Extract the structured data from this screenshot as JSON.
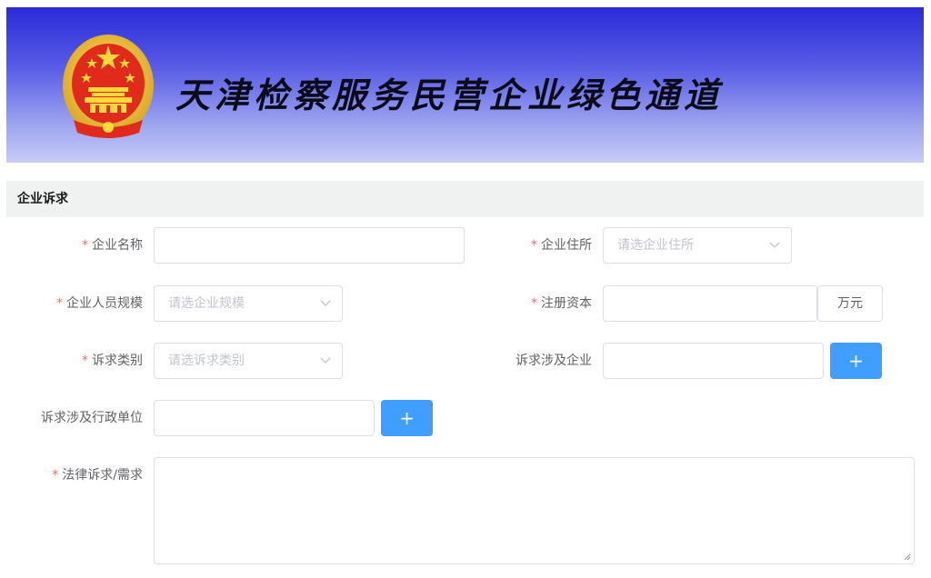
{
  "banner": {
    "title": "天津检察服务民营企业绿色通道",
    "emblem_icon": "national-emblem-icon"
  },
  "section": {
    "title": "企业诉求"
  },
  "form": {
    "company_name": {
      "label": "企业名称",
      "required": true,
      "value": ""
    },
    "company_address": {
      "label": "企业住所",
      "required": true,
      "placeholder": "请选企业住所"
    },
    "staff_size": {
      "label": "企业人员规模",
      "required": true,
      "placeholder": "请选企业规模"
    },
    "registered_capital": {
      "label": "注册资本",
      "required": true,
      "value": "",
      "unit": "万元"
    },
    "appeal_category": {
      "label": "诉求类别",
      "required": true,
      "placeholder": "请选诉求类别"
    },
    "related_company": {
      "label": "诉求涉及企业",
      "required": false,
      "value": "",
      "add_label": "+"
    },
    "related_agency": {
      "label": "诉求涉及行政单位",
      "required": false,
      "value": "",
      "add_label": "+"
    },
    "legal_appeal": {
      "label": "法律诉求/需求",
      "required": true,
      "value": ""
    }
  },
  "colors": {
    "required_mark": "#f56c6c",
    "primary": "#409eff",
    "banner_top": "#2a2ad8",
    "banner_bottom": "#c8ccf6"
  }
}
